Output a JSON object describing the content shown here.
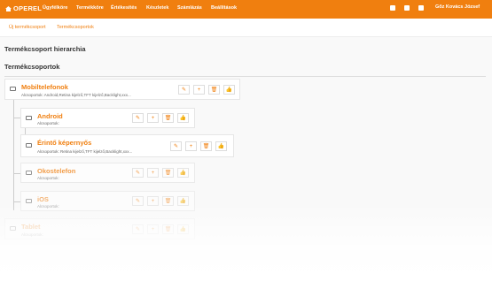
{
  "topbar": {
    "brand": "OPEREL",
    "nav": [
      "Ügyfélköre",
      "Termékköre",
      "Értékesítés",
      "Készletek",
      "Számlázás",
      "Beállítások"
    ],
    "user": "Gőz Kovács József",
    "icons": [
      "facebook-icon",
      "twitter-icon",
      "user-icon"
    ],
    "color": "#f07f0f"
  },
  "subnav": {
    "new_group": "Új termékcsoport",
    "groups": "Termékcsoportok"
  },
  "main": {
    "page_title": "Termékcsoport hierarchia",
    "section_title": "Termékcsoportok"
  },
  "tree": [
    {
      "name": "Mobiltelefonok",
      "sub": "Alcsoportok: Android,Retina kijelző,TFT kijelző,Backlight,xxx..."
    },
    {
      "name": "Android",
      "sub": "Alcsoportok:"
    },
    {
      "name": "Érintő képernyős",
      "sub": "Alcsoportok: Retina kijelző,TFT kijelző,Backlight,xxx..."
    },
    {
      "name": "Okostelefon",
      "sub": "Alcsoportok:"
    },
    {
      "name": "iOS",
      "sub": "Alcsoportok:"
    },
    {
      "name": "Tablet",
      "sub": "Alcsoportok:"
    }
  ],
  "buttons": {
    "edit": "✎",
    "add": "+",
    "delete": "🗑",
    "like": "👍"
  }
}
